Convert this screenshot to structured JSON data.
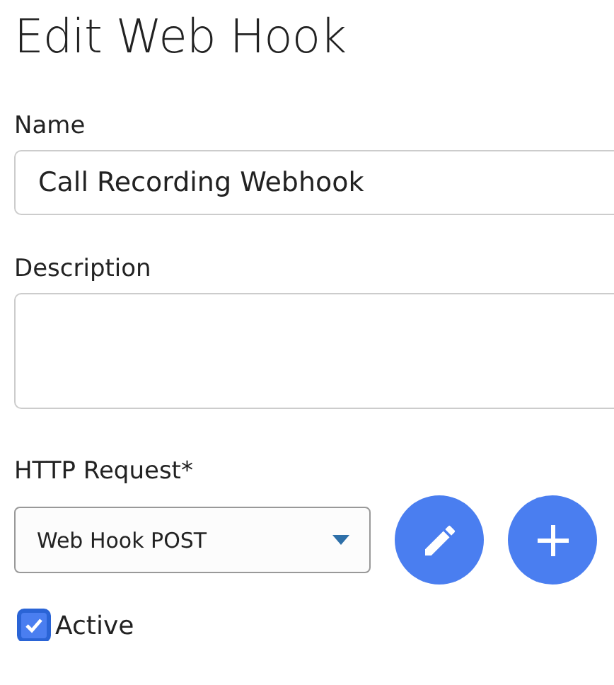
{
  "title": "Edit Web Hook",
  "name_field": {
    "label": "Name",
    "value": "Call Recording Webhook"
  },
  "description_field": {
    "label": "Description"
  },
  "http_request": {
    "label": "HTTP Request*",
    "value": "Web Hook POST"
  },
  "active": {
    "label": "Active",
    "checked": true
  }
}
